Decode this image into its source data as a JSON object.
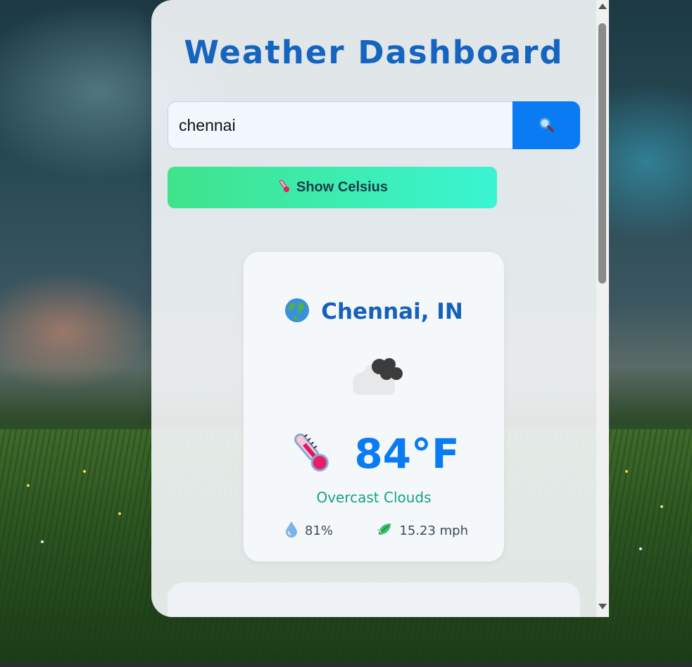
{
  "header": {
    "title": "Weather Dashboard"
  },
  "search": {
    "value": "chennai",
    "button_icon": "magnifier-icon"
  },
  "unit_toggle": {
    "label": "Show Celsius",
    "icon": "thermometer-icon"
  },
  "current": {
    "location_icon": "globe-icon",
    "location": "Chennai, IN",
    "condition_icon": "cloud-icon",
    "temperature": "84°F",
    "description": "Overcast Clouds",
    "humidity": "81%",
    "wind": "15.23 mph"
  },
  "colors": {
    "title": "#1565c0",
    "accent": "#0a7bf2",
    "description": "#16a085",
    "toggle_start": "#3fe38a",
    "toggle_end": "#3af5d3"
  }
}
